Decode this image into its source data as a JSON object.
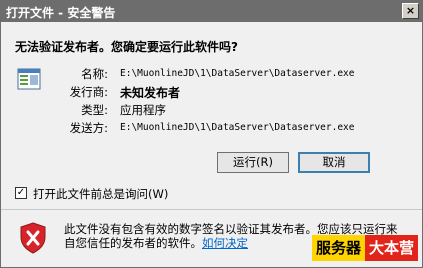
{
  "window": {
    "title": "打开文件 - 安全警告",
    "close_glyph": "×"
  },
  "dialog": {
    "question": "无法验证发布者。您确定要运行此软件吗?",
    "fields": [
      {
        "label": "名称:",
        "value": "E:\\MuonlineJD\\1\\DataServer\\Dataserver.exe"
      },
      {
        "label": "发行商:",
        "value": "未知发布者"
      },
      {
        "label": "类型:",
        "value": "应用程序"
      },
      {
        "label": "发送方:",
        "value": "E:\\MuonlineJD\\1\\DataServer\\Dataserver.exe"
      }
    ],
    "buttons": {
      "run": "运行(R)",
      "cancel": "取消"
    },
    "checkbox": {
      "label": "打开此文件前总是询问(W)",
      "checked": true,
      "check_glyph": "✓"
    },
    "warning": {
      "text": "此文件没有包含有效的数字签名以验证其发布者。您应该只运行来自您信任的发布者的软件。",
      "link": "如何决定"
    }
  },
  "watermark": {
    "part1": "服务器",
    "part2": "大本营"
  },
  "colors": {
    "titlebar": "#6d6d6d",
    "link": "#0066cc",
    "badge_yellow": "#ffd400",
    "badge_red": "#e2251b"
  }
}
